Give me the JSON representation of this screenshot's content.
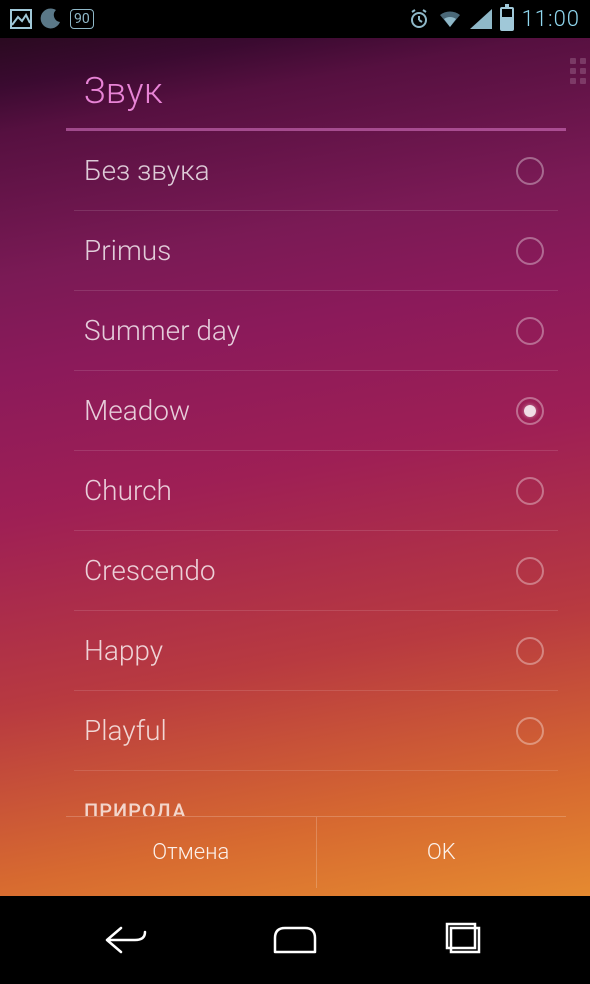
{
  "statusbar": {
    "time": "11:00",
    "battery_text": "90"
  },
  "dialog": {
    "title": "Звук",
    "items": [
      {
        "label": "Без звука",
        "selected": false
      },
      {
        "label": "Primus",
        "selected": false
      },
      {
        "label": "Summer day",
        "selected": false
      },
      {
        "label": "Meadow",
        "selected": true
      },
      {
        "label": "Church",
        "selected": false
      },
      {
        "label": "Crescendo",
        "selected": false
      },
      {
        "label": "Happy",
        "selected": false
      },
      {
        "label": "Playful",
        "selected": false
      }
    ],
    "section_header": "ПРИРОДА",
    "cancel_label": "Отмена",
    "ok_label": "OK"
  }
}
